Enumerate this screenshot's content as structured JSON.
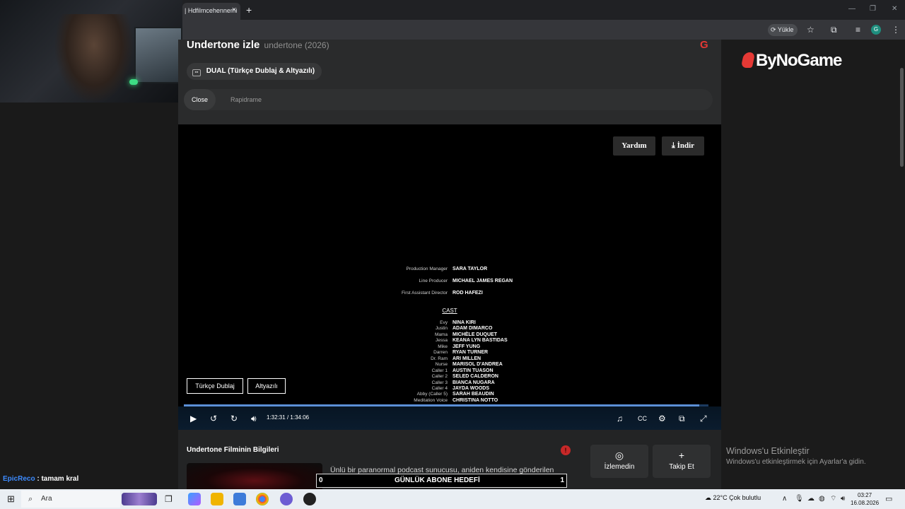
{
  "browser": {
    "tab_title": "| Hdfilmcehennemi",
    "tab_close": "×",
    "new_tab": "+",
    "update_label": "Yükle",
    "profile_letter": "G",
    "window_min": "—",
    "window_max": "❐",
    "window_close": "✕"
  },
  "page": {
    "title": "Undertone izle",
    "subtitle": "undertone (2026)",
    "brand_mark": "G",
    "dual_label": "DUAL (Türkçe Dublaj & Altyazılı)",
    "sources": [
      {
        "label": "Close"
      },
      {
        "label": "Rapidrame"
      }
    ]
  },
  "player": {
    "help_label": "Yardım",
    "download_label": "İndir",
    "credits": {
      "crew": [
        {
          "role": "Production Manager",
          "name": "SARA TAYLOR"
        },
        {
          "role": "Line Producer",
          "name": "MICHAEL JAMES REGAN"
        },
        {
          "role": "First Assistant Director",
          "name": "ROD HAFEZI"
        }
      ],
      "cast_heading": "CAST",
      "cast": [
        {
          "role": "Evy",
          "name": "NINA KIRI"
        },
        {
          "role": "Justin",
          "name": "ADAM DIMARCO"
        },
        {
          "role": "Mama",
          "name": "MICHÈLE DUQUET"
        },
        {
          "role": "Jessa",
          "name": "KEANA LYN BASTIDAS"
        },
        {
          "role": "Mike",
          "name": "JEFF YUNG"
        },
        {
          "role": "Darren",
          "name": "RYAN TURNER"
        },
        {
          "role": "Dr. Ram",
          "name": "ARI MILLEN"
        },
        {
          "role": "Nurse",
          "name": "MARISOL D'ANDREA"
        },
        {
          "role": "Caller 1",
          "name": "AUSTIN TUASON"
        },
        {
          "role": "Caller 2",
          "name": "SELED CALDERON"
        },
        {
          "role": "Caller 3",
          "name": "BIANCA NUGARA"
        },
        {
          "role": "Caller 4",
          "name": "JAYDA WOODS"
        },
        {
          "role": "Abby (Caller 5)",
          "name": "SARAH BEAUDIN"
        },
        {
          "role": "Meditation Voice",
          "name": "CHRISTINA NOTTO"
        }
      ]
    },
    "dub_label": "Türkçe Dublaj",
    "sub_label": "Altyazılı",
    "current_time": "1:32:31",
    "time_sep": "/",
    "duration": "1:34:06",
    "progress": 0.983
  },
  "info": {
    "title": "Undertone Filminin Bilgileri",
    "description": "Ünlü bir paranormal podcast sunucusu, aniden kendisine gönderilen korkutucu kayıtlarla",
    "warn_icon": "!",
    "unwatched_label": "İzlemedin",
    "follow_label": "Takip Et"
  },
  "sidebar": {
    "brand": "ByNoGame",
    "activate_title": "Windows'u Etkinleştir",
    "activate_sub": "Windows'u etkinleştirmek için Ayarlar'a gidin."
  },
  "overlay": {
    "chat_user": "EpicReco",
    "chat_msg": " : tamam kral",
    "goal_left": "0",
    "goal_label": "GÜNLÜK ABONE HEDEFİ",
    "goal_right": "1"
  },
  "taskbar": {
    "search_placeholder": "Ara",
    "weather": "22°C  Çok bulutlu",
    "time": "03:27",
    "date": "16.08.2026"
  }
}
